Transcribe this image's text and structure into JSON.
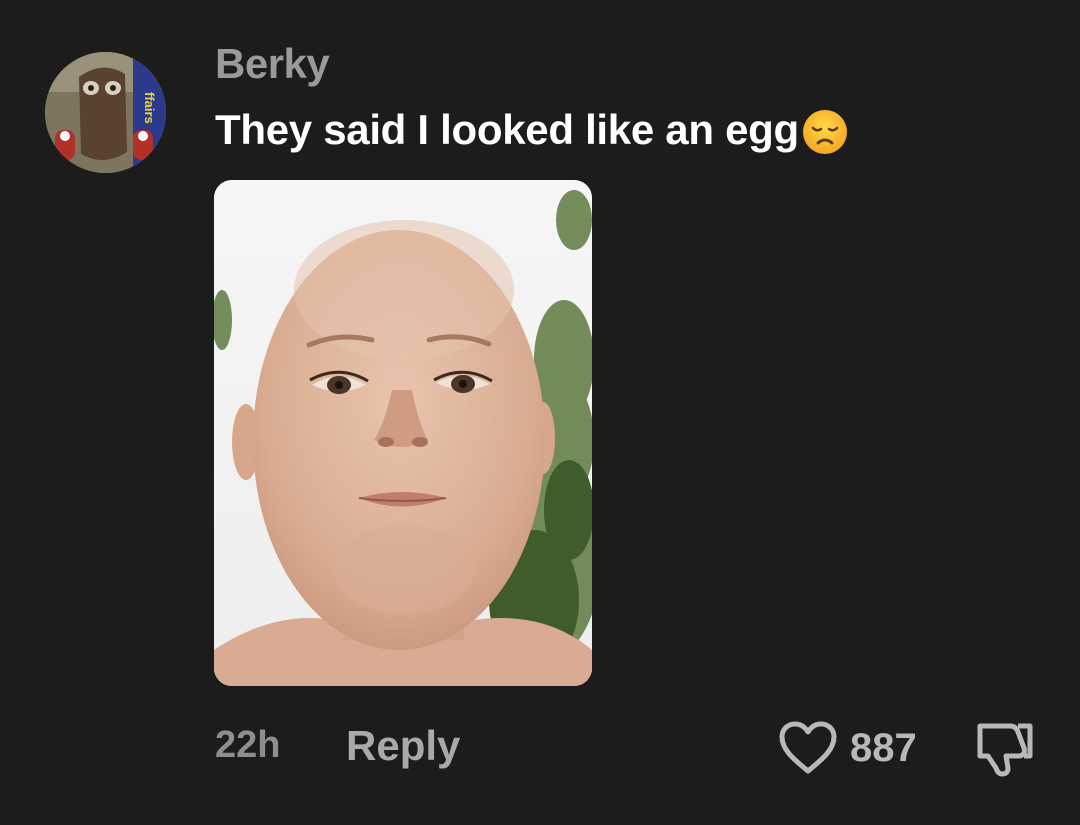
{
  "comment": {
    "username": "Berky",
    "text": "They said I looked like an egg",
    "emoji": "disappointed-face-emoji",
    "avatar_text": "ffairs",
    "time": "22h",
    "reply_label": "Reply",
    "like_count": "887"
  },
  "colors": {
    "background": "#1c1c1d",
    "username": "#9a9a9c",
    "text": "#ffffff",
    "muted": "#8e8e90"
  },
  "icons": {
    "like": "heart-outline-icon",
    "dislike": "thumbs-down-outline-icon"
  }
}
